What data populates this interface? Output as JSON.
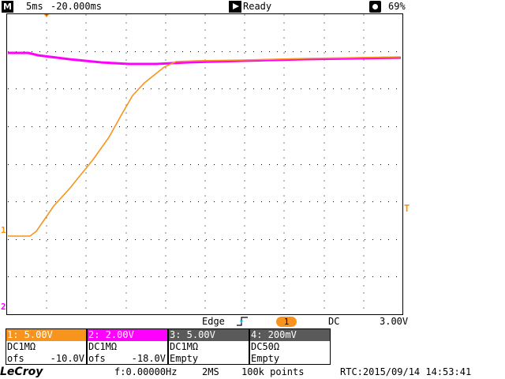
{
  "topbar": {
    "mode_icon": "M",
    "timebase": "5ms",
    "delay": "-20.000ms",
    "status": "Ready",
    "brightness": "69%",
    "icons": [
      "menu-m-icon",
      "run-play-icon",
      "brightness-icon"
    ]
  },
  "markers": {
    "ch1": "1",
    "ch2": "2",
    "trigger_level": "T"
  },
  "trigger": {
    "type": "Edge",
    "source": "1",
    "coupling": "DC",
    "level": "3.00V"
  },
  "channels": [
    {
      "header": "1: 5.00V",
      "coupling": "DC1MΩ",
      "offset_label": "ofs",
      "offset_value": "-10.0V",
      "color": "#f7941d",
      "header_text_color": "#ffffff"
    },
    {
      "header": "2: 2.00V",
      "coupling": "DC1MΩ",
      "offset_label": "ofs",
      "offset_value": "-18.0V",
      "color": "#ff00ff",
      "header_text_color": "#ffffff"
    },
    {
      "header": "3: 5.00V",
      "coupling": "DC1MΩ",
      "offset_label": "Empty",
      "offset_value": "",
      "color": "#5a5a5a",
      "header_text_color": "#ffffff"
    },
    {
      "header": "4: 200mV",
      "coupling": "DC50Ω",
      "offset_label": "Empty",
      "offset_value": "",
      "color": "#5a5a5a",
      "header_text_color": "#ffffff"
    }
  ],
  "bottombar": {
    "logo": "LeCroy",
    "frequency": "f:0.00000Hz",
    "sample_rate": "2MS",
    "record_length": "100k points",
    "rtc": "RTC:2015/09/14 14:53:41"
  },
  "colors": {
    "ch1": "#f7941d",
    "ch2": "#ff00ff",
    "grid": "#000000",
    "trigger_edge": "#00b4ff"
  }
}
